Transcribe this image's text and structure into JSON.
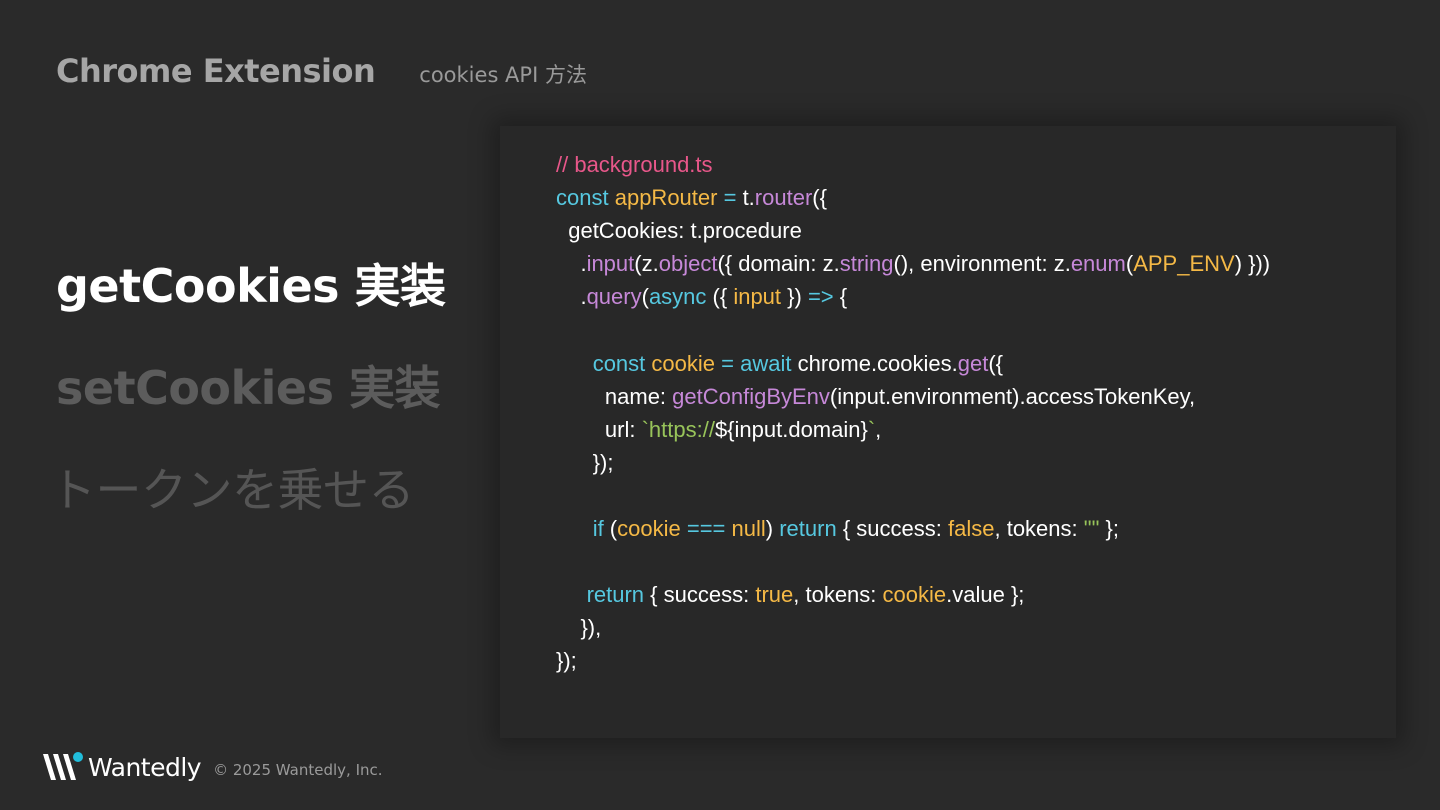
{
  "header": {
    "title": "Chrome Extension",
    "subtitle": "cookies API 方法"
  },
  "menu": {
    "items": [
      {
        "label": "getCookies 実装",
        "state": "active"
      },
      {
        "label": "setCookies 実装",
        "state": "inactive"
      },
      {
        "label": "トークンを乗せる",
        "state": "inactive"
      }
    ]
  },
  "code": {
    "filename_comment": "// background.ts",
    "language": "typescript",
    "lines": [
      "// background.ts",
      "const appRouter = t.router({",
      "  getCookies: t.procedure",
      "    .input(z.object({ domain: z.string(), environment: z.enum(APP_ENV) }))",
      "    .query(async ({ input }) => {",
      "",
      "      const cookie = await chrome.cookies.get({",
      "        name: getConfigByEnv(input.environment).accessTokenKey,",
      "        url: `https://${input.domain}`,",
      "      });",
      "",
      "      if (cookie === null) return { success: false, tokens: \"\" };",
      "",
      "     return { success: true, tokens: cookie.value };",
      "    }),",
      "});"
    ]
  },
  "colors": {
    "background": "#2a2a2a",
    "keyword": "#56c8e0",
    "variable": "#f5b946",
    "function": "#c688d8",
    "string": "#98c45a",
    "comment": "#e8578a"
  },
  "footer": {
    "brand": "Wantedly",
    "logo_icon": "wantedly-logo-icon",
    "copyright": "© 2025 Wantedly, Inc."
  }
}
